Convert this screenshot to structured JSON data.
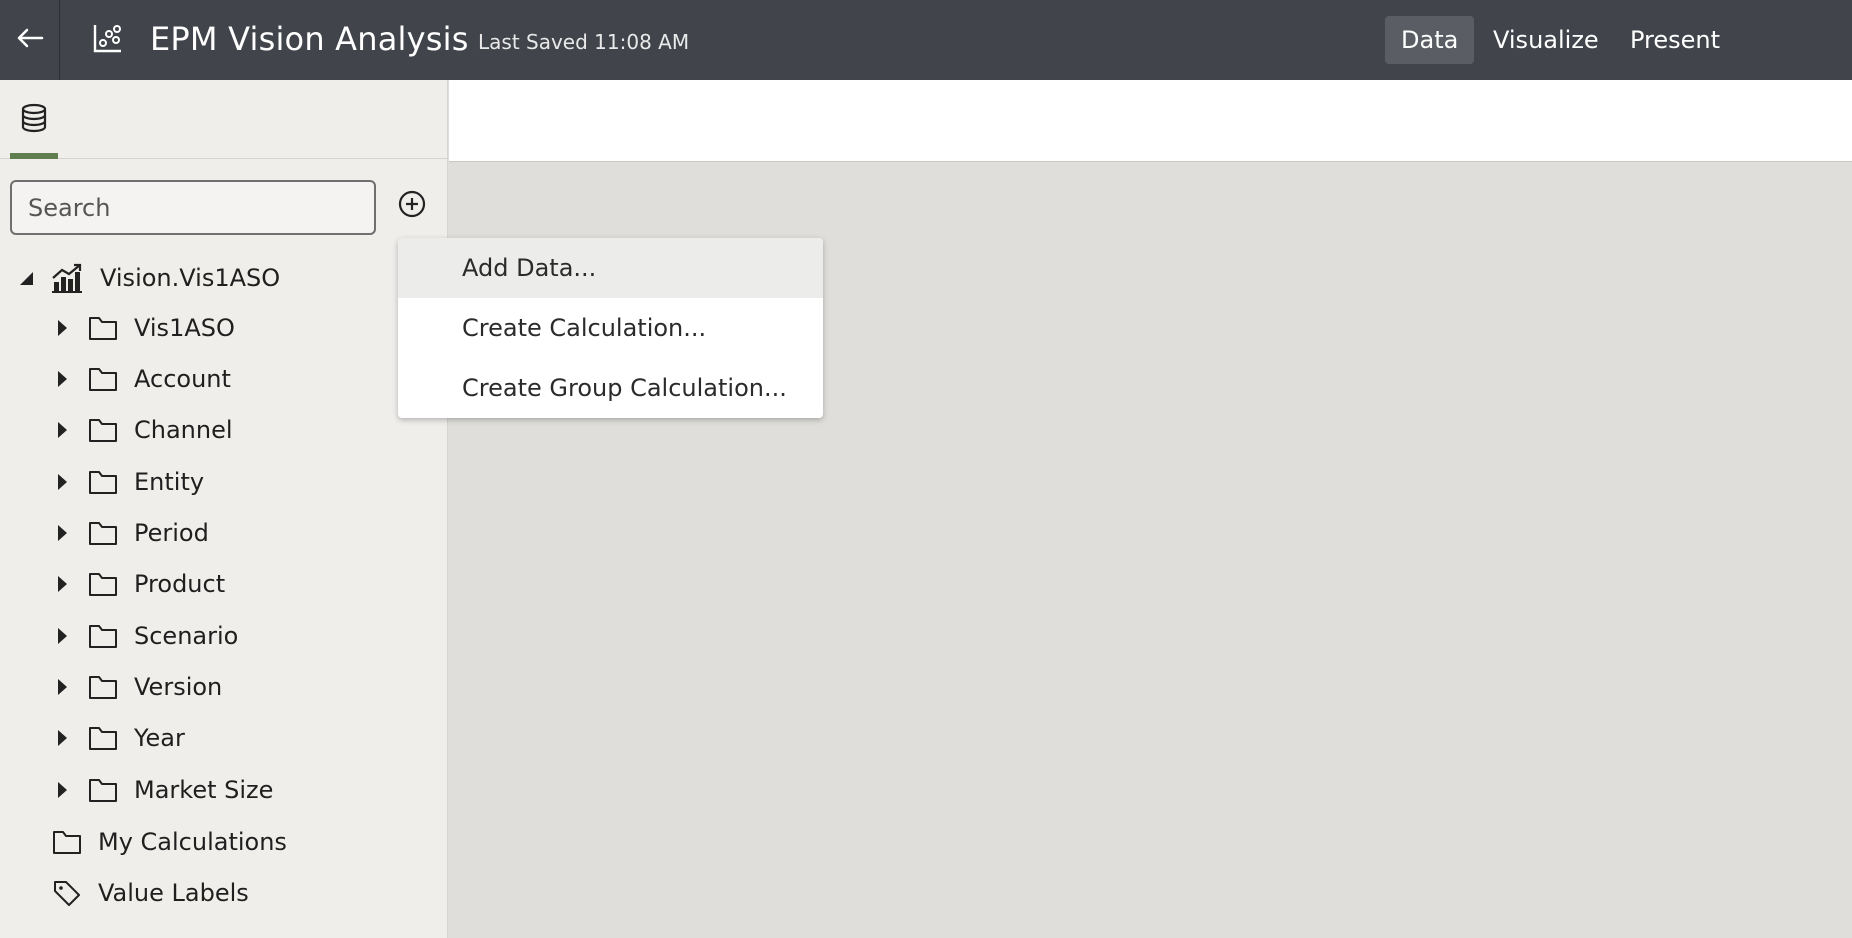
{
  "header": {
    "back_icon": "arrow-left-icon",
    "app_icon": "scatter-chart-icon",
    "title": "EPM Vision Analysis",
    "last_saved": "Last Saved 11:08 AM",
    "tabs": [
      {
        "label": "Data",
        "active": true
      },
      {
        "label": "Visualize",
        "active": false
      },
      {
        "label": "Present",
        "active": false
      }
    ]
  },
  "sidebar": {
    "tab_icon": "database-icon",
    "search": {
      "placeholder": "Search",
      "value": ""
    },
    "add_icon": "plus-circle-icon",
    "tree": {
      "root": {
        "label": "Vision.Vis1ASO",
        "icon": "chart-icon",
        "expanded": true
      },
      "children": [
        {
          "label": "Vis1ASO"
        },
        {
          "label": "Account"
        },
        {
          "label": "Channel"
        },
        {
          "label": "Entity"
        },
        {
          "label": "Period"
        },
        {
          "label": "Product"
        },
        {
          "label": "Scenario"
        },
        {
          "label": "Version"
        },
        {
          "label": "Year"
        },
        {
          "label": "Market Size"
        }
      ],
      "my_calculations": "My Calculations",
      "value_labels": "Value Labels"
    }
  },
  "menu": {
    "items": [
      {
        "label": "Add Data...",
        "highlighted": true
      },
      {
        "label": "Create Calculation...",
        "highlighted": false
      },
      {
        "label": "Create Group Calculation...",
        "highlighted": false
      }
    ]
  },
  "colors": {
    "header_bg": "#41454b",
    "active_tab_bg": "#5a5e64",
    "sidebar_bg": "#efeeeb",
    "accent": "#5f7d4f",
    "canvas_bg": "#dfdedb"
  }
}
